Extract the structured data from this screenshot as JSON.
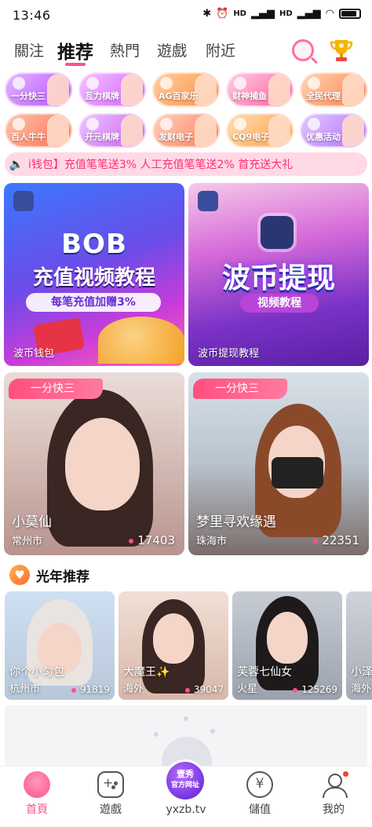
{
  "status_bar": {
    "time": "13:46",
    "signal_1": "HD",
    "signal_2": "HD",
    "icons": [
      "bluetooth-icon",
      "alarm-icon",
      "signal-icon",
      "signal-icon",
      "wifi-icon",
      "battery-icon"
    ]
  },
  "top_nav": {
    "tabs": [
      {
        "label": "關注",
        "active": false
      },
      {
        "label": "推荐",
        "active": true
      },
      {
        "label": "熱門",
        "active": false
      },
      {
        "label": "遊戲",
        "active": false
      },
      {
        "label": "附近",
        "active": false
      }
    ],
    "accent": "#ff4f8b"
  },
  "shortcuts": [
    {
      "label": "一分快三",
      "color": "#b24dff"
    },
    {
      "label": "瓦力棋牌",
      "color": "#d05cff"
    },
    {
      "label": "AG百家乐",
      "color": "#ff8a3d"
    },
    {
      "label": "财神捕鱼",
      "color": "#ff5aa0"
    },
    {
      "label": "全民代理",
      "color": "#ff7a45"
    },
    {
      "label": "百人牛牛",
      "color": "#ff6b4a"
    },
    {
      "label": "开元棋牌",
      "color": "#c85cf2"
    },
    {
      "label": "发财电子",
      "color": "#ff7b52"
    },
    {
      "label": "CQ9电子",
      "color": "#ff9f43"
    },
    {
      "label": "优惠活动",
      "color": "#b36cff"
    }
  ],
  "notice": {
    "text": "i钱包】充值笔笔送3% 人工充值笔笔送2%  首充送大礼"
  },
  "banners": [
    {
      "headline": "BOB",
      "subtitle": "充值视频教程",
      "bonus": "每笔充值加赠3%",
      "caption": "波币钱包"
    },
    {
      "headline": "波币提现",
      "pill": "视频教程",
      "caption": "波币提现教程"
    }
  ],
  "featured": [
    {
      "tag": "一分快三",
      "name": "小莫仙",
      "city": "常州市",
      "count": "17403"
    },
    {
      "tag": "一分快三",
      "name": "梦里寻欢缘遇",
      "city": "珠海市",
      "count": "22351"
    }
  ],
  "section": {
    "title": "光年推荐"
  },
  "recommend": [
    {
      "name": "你个小匀包",
      "city": "杭州市",
      "count": "91819"
    },
    {
      "name": "大魔王✨",
      "city": "海外",
      "count": "39047"
    },
    {
      "name": "芙蓉七仙女",
      "city": "火星",
      "count": "125269"
    },
    {
      "name": "小泽",
      "city": "海外",
      "count": ""
    }
  ],
  "bottom_nav": {
    "items": [
      {
        "label": "首頁",
        "icon": "home-icon"
      },
      {
        "label": "遊戲",
        "icon": "gamepad-icon"
      },
      {
        "label": "yxzb.tv",
        "icon": "site-logo-icon"
      },
      {
        "label": "儲值",
        "icon": "wallet-icon"
      },
      {
        "label": "我的",
        "icon": "profile-icon"
      }
    ],
    "center_logo_line1": "壹秀",
    "center_logo_line2": "官方网址"
  }
}
